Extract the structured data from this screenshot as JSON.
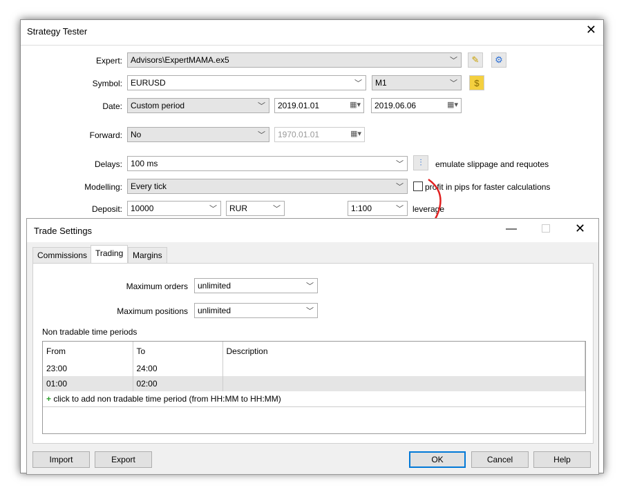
{
  "window": {
    "title": "Strategy Tester",
    "close": "✕"
  },
  "form": {
    "expert": {
      "label": "Expert:",
      "value": "Advisors\\ExpertMAMA.ex5"
    },
    "symbol": {
      "label": "Symbol:",
      "value": "EURUSD",
      "period": "M1"
    },
    "date": {
      "label": "Date:",
      "value": "Custom period",
      "from": "2019.01.01",
      "to": "2019.06.06"
    },
    "forward": {
      "label": "Forward:",
      "value": "No",
      "date": "1970.01.01"
    },
    "delays": {
      "label": "Delays:",
      "value": "100 ms",
      "note": "emulate slippage and requotes"
    },
    "modelling": {
      "label": "Modelling:",
      "value": "Every tick",
      "checkbox": "profit in pips for faster calculations",
      "checked": false
    },
    "deposit": {
      "label": "Deposit:",
      "value": "10000",
      "currency": "RUR",
      "leverage": "1:100",
      "leverage_label": "leverage"
    }
  },
  "dialog": {
    "title": "Trade Settings",
    "tabs": [
      "Commissions",
      "Trading",
      "Margins"
    ],
    "active_tab": "Trading",
    "max_orders": {
      "label": "Maximum orders",
      "value": "unlimited"
    },
    "max_positions": {
      "label": "Maximum positions",
      "value": "unlimited"
    },
    "periods_label": "Non tradable time periods",
    "columns": [
      "From",
      "To",
      "Description"
    ],
    "rows": [
      {
        "from": "23:00",
        "to": "24:00",
        "desc": ""
      },
      {
        "from": "01:00",
        "to": "02:00",
        "desc": ""
      }
    ],
    "add_row": "click to add non tradable time period (from HH:MM to HH:MM)",
    "buttons": {
      "import": "Import",
      "export": "Export",
      "ok": "OK",
      "cancel": "Cancel",
      "help": "Help"
    }
  },
  "colors": {
    "accent": "#0078d7",
    "arrow": "#e02020",
    "plus": "#2ca02c"
  }
}
